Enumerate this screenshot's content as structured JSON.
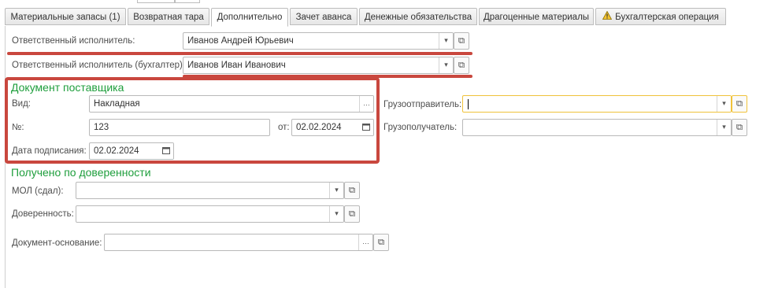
{
  "tabs": [
    {
      "label": "Материальные запасы (1)"
    },
    {
      "label": "Возвратная тара"
    },
    {
      "label": "Дополнительно"
    },
    {
      "label": "Зачет аванса"
    },
    {
      "label": "Денежные обязательства"
    },
    {
      "label": "Драгоценные материалы"
    },
    {
      "label": "Бухгалтерская операция"
    }
  ],
  "active_tab": "Дополнительно",
  "responsible": {
    "label": "Ответственный исполнитель:",
    "value": "Иванов Андрей Юрьевич"
  },
  "responsible_accountant": {
    "label": "Ответственный исполнитель (бухгалтер):",
    "value": "Иванов Иван Иванович"
  },
  "supplier_doc": {
    "title": "Документ поставщика",
    "kind_label": "Вид:",
    "kind_value": "Накладная",
    "number_label": "№:",
    "number_value": "123",
    "date_label": "от:",
    "date_value": "02.02.2024",
    "sign_date_label": "Дата подписания:",
    "sign_date_value": "02.02.2024"
  },
  "shipper": {
    "label": "Грузоотправитель:",
    "value": ""
  },
  "consignee": {
    "label": "Грузополучатель:",
    "value": ""
  },
  "proxy": {
    "title": "Получено по доверенности",
    "mol_label": "МОЛ (сдал):",
    "mol_value": "",
    "proxy_label": "Доверенность:",
    "proxy_value": ""
  },
  "base_doc": {
    "label": "Документ-основание:",
    "value": ""
  },
  "colors": {
    "accent_green": "#1e9e3c",
    "highlight_red": "#c9473e",
    "focus_yellow": "#f0c23a"
  },
  "icons": {
    "dropdown": "chevron-down-icon",
    "open": "open-form-icon",
    "calendar": "calendar-icon",
    "select": "ellipsis-icon",
    "warning": "warning-icon"
  }
}
